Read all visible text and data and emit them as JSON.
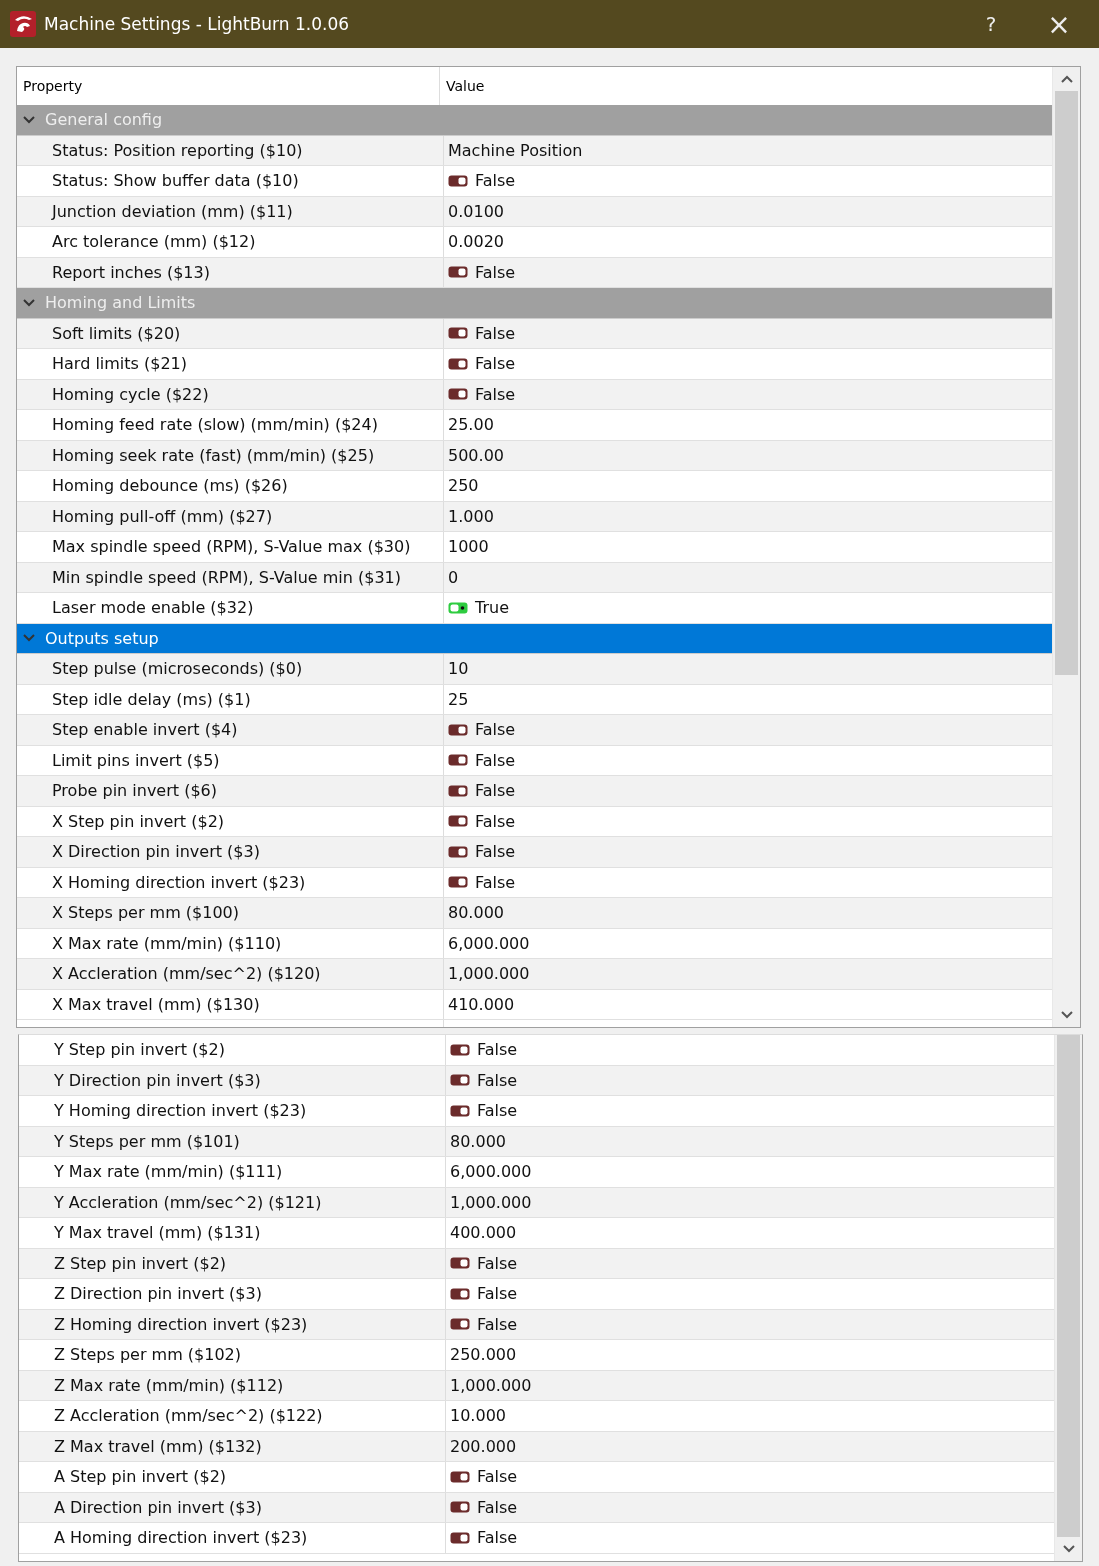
{
  "window": {
    "title": "Machine Settings - LightBurn 1.0.06",
    "help": "?",
    "close": "×"
  },
  "panels": [
    {
      "columns": [
        "Property",
        "Value"
      ],
      "groups": [
        {
          "label": "General config",
          "expanded": true,
          "selected": false,
          "rows": [
            {
              "property": "Status: Position reporting ($10)",
              "kind": "text",
              "value": "Machine Position"
            },
            {
              "property": "Status: Show buffer data ($10)",
              "kind": "toggle",
              "on": false,
              "value": "False"
            },
            {
              "property": "Junction deviation (mm) ($11)",
              "kind": "text",
              "value": "0.0100"
            },
            {
              "property": "Arc tolerance (mm) ($12)",
              "kind": "text",
              "value": "0.0020"
            },
            {
              "property": "Report inches ($13)",
              "kind": "toggle",
              "on": false,
              "value": "False"
            }
          ]
        },
        {
          "label": "Homing and Limits",
          "expanded": true,
          "selected": false,
          "rows": [
            {
              "property": "Soft limits ($20)",
              "kind": "toggle",
              "on": false,
              "value": "False"
            },
            {
              "property": "Hard limits ($21)",
              "kind": "toggle",
              "on": false,
              "value": "False"
            },
            {
              "property": "Homing cycle ($22)",
              "kind": "toggle",
              "on": false,
              "value": "False"
            },
            {
              "property": "Homing feed rate (slow) (mm/min) ($24)",
              "kind": "text",
              "value": "25.00"
            },
            {
              "property": "Homing seek rate (fast) (mm/min) ($25)",
              "kind": "text",
              "value": "500.00"
            },
            {
              "property": "Homing debounce (ms) ($26)",
              "kind": "text",
              "value": "250"
            },
            {
              "property": "Homing pull-off (mm) ($27)",
              "kind": "text",
              "value": "1.000"
            },
            {
              "property": "Max spindle speed (RPM), S-Value max ($30)",
              "kind": "text",
              "value": "1000"
            },
            {
              "property": "Min spindle speed (RPM), S-Value min ($31)",
              "kind": "text",
              "value": "0"
            },
            {
              "property": "Laser mode enable ($32)",
              "kind": "toggle",
              "on": true,
              "value": "True"
            }
          ]
        },
        {
          "label": "Outputs setup",
          "expanded": true,
          "selected": true,
          "rows": [
            {
              "property": "Step pulse (microseconds) ($0)",
              "kind": "text",
              "value": "10"
            },
            {
              "property": "Step idle delay (ms) ($1)",
              "kind": "text",
              "value": "25"
            },
            {
              "property": "Step enable invert ($4)",
              "kind": "toggle",
              "on": false,
              "value": "False"
            },
            {
              "property": "Limit pins invert ($5)",
              "kind": "toggle",
              "on": false,
              "value": "False"
            },
            {
              "property": "Probe pin invert ($6)",
              "kind": "toggle",
              "on": false,
              "value": "False"
            },
            {
              "property": "X Step pin invert ($2)",
              "kind": "toggle",
              "on": false,
              "value": "False"
            },
            {
              "property": "X Direction pin invert ($3)",
              "kind": "toggle",
              "on": false,
              "value": "False"
            },
            {
              "property": "X Homing direction invert ($23)",
              "kind": "toggle",
              "on": false,
              "value": "False"
            },
            {
              "property": "X Steps per mm ($100)",
              "kind": "text",
              "value": "80.000"
            },
            {
              "property": "X Max rate (mm/min) ($110)",
              "kind": "text",
              "value": "6,000.000"
            },
            {
              "property": "X Accleration (mm/sec^2) ($120)",
              "kind": "text",
              "value": "1,000.000"
            },
            {
              "property": "X Max travel (mm) ($130)",
              "kind": "text",
              "value": "410.000"
            }
          ]
        }
      ]
    },
    {
      "groups": [
        {
          "rows": [
            {
              "property": "Y Step pin invert ($2)",
              "kind": "toggle",
              "on": false,
              "value": "False"
            },
            {
              "property": "Y Direction pin invert ($3)",
              "kind": "toggle",
              "on": false,
              "value": "False"
            },
            {
              "property": "Y Homing direction invert ($23)",
              "kind": "toggle",
              "on": false,
              "value": "False"
            },
            {
              "property": "Y Steps per mm ($101)",
              "kind": "text",
              "value": "80.000"
            },
            {
              "property": "Y Max rate (mm/min) ($111)",
              "kind": "text",
              "value": "6,000.000"
            },
            {
              "property": "Y Accleration (mm/sec^2) ($121)",
              "kind": "text",
              "value": "1,000.000"
            },
            {
              "property": "Y Max travel (mm) ($131)",
              "kind": "text",
              "value": "400.000"
            },
            {
              "property": "Z Step pin invert ($2)",
              "kind": "toggle",
              "on": false,
              "value": "False"
            },
            {
              "property": "Z Direction pin invert ($3)",
              "kind": "toggle",
              "on": false,
              "value": "False"
            },
            {
              "property": "Z Homing direction invert ($23)",
              "kind": "toggle",
              "on": false,
              "value": "False"
            },
            {
              "property": "Z Steps per mm ($102)",
              "kind": "text",
              "value": "250.000"
            },
            {
              "property": "Z Max rate (mm/min) ($112)",
              "kind": "text",
              "value": "1,000.000"
            },
            {
              "property": "Z Accleration (mm/sec^2) ($122)",
              "kind": "text",
              "value": "10.000"
            },
            {
              "property": "Z Max travel (mm) ($132)",
              "kind": "text",
              "value": "200.000"
            },
            {
              "property": "A Step pin invert ($2)",
              "kind": "toggle",
              "on": false,
              "value": "False"
            },
            {
              "property": "A Direction pin invert ($3)",
              "kind": "toggle",
              "on": false,
              "value": "False"
            },
            {
              "property": "A Homing direction invert ($23)",
              "kind": "toggle",
              "on": false,
              "value": "False"
            }
          ]
        }
      ]
    }
  ]
}
